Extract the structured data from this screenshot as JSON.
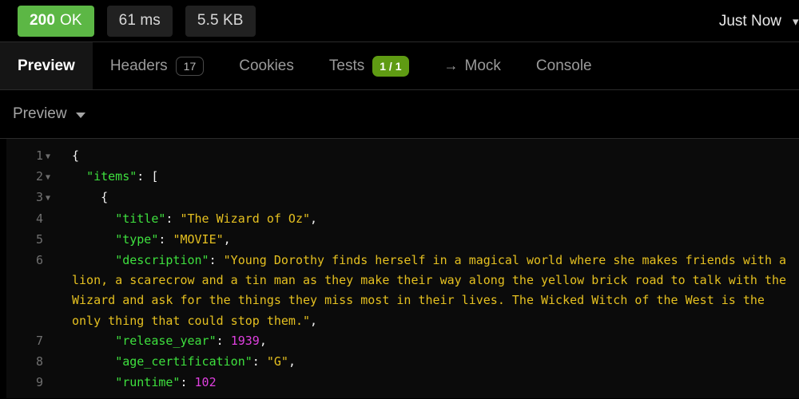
{
  "status_bar": {
    "status_code": "200",
    "status_text": "OK",
    "status_color": "#5cb745",
    "duration": "61 ms",
    "size": "5.5 KB",
    "timestamp": "Just Now",
    "clipped_icon": "▾"
  },
  "tabs": [
    {
      "label": "Preview",
      "active": true,
      "badge": null,
      "badge_type": "none",
      "icon": null
    },
    {
      "label": "Headers",
      "active": false,
      "badge": "17",
      "badge_type": "outline",
      "icon": null
    },
    {
      "label": "Cookies",
      "active": false,
      "badge": null,
      "badge_type": "none",
      "icon": null
    },
    {
      "label": "Tests",
      "active": false,
      "badge": "1 / 1",
      "badge_type": "pass",
      "icon": null
    },
    {
      "label": "Mock",
      "active": false,
      "badge": null,
      "badge_type": "none",
      "icon": "→"
    },
    {
      "label": "Console",
      "active": false,
      "badge": null,
      "badge_type": "none",
      "icon": null
    }
  ],
  "sub_toolbar": {
    "view_mode": "Preview",
    "caret_icon": "chevron-down-icon"
  },
  "code": {
    "language": "json",
    "colors": {
      "key": "#3ee03e",
      "string": "#e5c020",
      "number": "#e040e0",
      "punctuation": "#f2f2f2",
      "gutter": "#707070",
      "background": "#0b0b0b"
    },
    "lines": [
      {
        "num": "1",
        "foldable": true,
        "tokens": [
          {
            "t": "punct",
            "v": "{"
          }
        ]
      },
      {
        "num": "2",
        "foldable": true,
        "tokens": [
          {
            "t": "punct",
            "v": "  "
          },
          {
            "t": "key",
            "v": "\"items\""
          },
          {
            "t": "punct",
            "v": ": ["
          }
        ]
      },
      {
        "num": "3",
        "foldable": true,
        "tokens": [
          {
            "t": "punct",
            "v": "    {"
          }
        ]
      },
      {
        "num": "4",
        "foldable": false,
        "tokens": [
          {
            "t": "punct",
            "v": "      "
          },
          {
            "t": "key",
            "v": "\"title\""
          },
          {
            "t": "punct",
            "v": ": "
          },
          {
            "t": "str",
            "v": "\"The Wizard of Oz\""
          },
          {
            "t": "punct",
            "v": ","
          }
        ]
      },
      {
        "num": "5",
        "foldable": false,
        "tokens": [
          {
            "t": "punct",
            "v": "      "
          },
          {
            "t": "key",
            "v": "\"type\""
          },
          {
            "t": "punct",
            "v": ": "
          },
          {
            "t": "str",
            "v": "\"MOVIE\""
          },
          {
            "t": "punct",
            "v": ","
          }
        ]
      },
      {
        "num": "6",
        "foldable": false,
        "tokens": [
          {
            "t": "punct",
            "v": "      "
          },
          {
            "t": "key",
            "v": "\"description\""
          },
          {
            "t": "punct",
            "v": ": "
          },
          {
            "t": "str",
            "v": "\"Young Dorothy finds herself in a magical world where she makes friends with a lion, a scarecrow and a tin man as they make their way along the yellow brick road to talk with the Wizard and ask for the things they miss most in their lives. The Wicked Witch of the West is the only thing that could stop them.\""
          },
          {
            "t": "punct",
            "v": ","
          }
        ]
      },
      {
        "num": "7",
        "foldable": false,
        "tokens": [
          {
            "t": "punct",
            "v": "      "
          },
          {
            "t": "key",
            "v": "\"release_year\""
          },
          {
            "t": "punct",
            "v": ": "
          },
          {
            "t": "num",
            "v": "1939"
          },
          {
            "t": "punct",
            "v": ","
          }
        ]
      },
      {
        "num": "8",
        "foldable": false,
        "tokens": [
          {
            "t": "punct",
            "v": "      "
          },
          {
            "t": "key",
            "v": "\"age_certification\""
          },
          {
            "t": "punct",
            "v": ": "
          },
          {
            "t": "str",
            "v": "\"G\""
          },
          {
            "t": "punct",
            "v": ","
          }
        ]
      },
      {
        "num": "9",
        "foldable": false,
        "tokens": [
          {
            "t": "punct",
            "v": "      "
          },
          {
            "t": "key",
            "v": "\"runtime\""
          },
          {
            "t": "punct",
            "v": ": "
          },
          {
            "t": "num",
            "v": "102"
          }
        ]
      }
    ]
  }
}
